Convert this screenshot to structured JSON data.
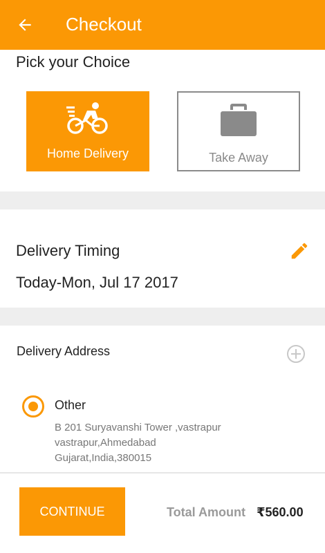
{
  "appbar": {
    "title": "Checkout",
    "back_icon": "arrow-left-icon",
    "background": "#fb9805"
  },
  "choice": {
    "heading": "Pick your Choice",
    "options": [
      {
        "label": "Home Delivery",
        "icon": "delivery-bike-icon",
        "selected": true
      },
      {
        "label": "Take Away",
        "icon": "briefcase-icon",
        "selected": false
      }
    ]
  },
  "timing": {
    "title": "Delivery Timing",
    "value": "Today-Mon, Jul 17 2017",
    "edit_icon": "pencil-icon"
  },
  "address": {
    "title": "Delivery Address",
    "add_icon": "plus-circle-icon",
    "entries": [
      {
        "type": "Other",
        "selected": true,
        "lines": [
          "B 201 Suryavanshi Tower ,vastrapur",
          "vastrapur,Ahmedabad",
          "Gujarat,India,380015"
        ]
      }
    ]
  },
  "footer": {
    "continue_label": "CONTINUE",
    "total_label": "Total Amount",
    "total_value": "₹560.00"
  },
  "colors": {
    "accent": "#fb9805",
    "band": "#eeeeee",
    "muted": "#8a8a8a"
  }
}
